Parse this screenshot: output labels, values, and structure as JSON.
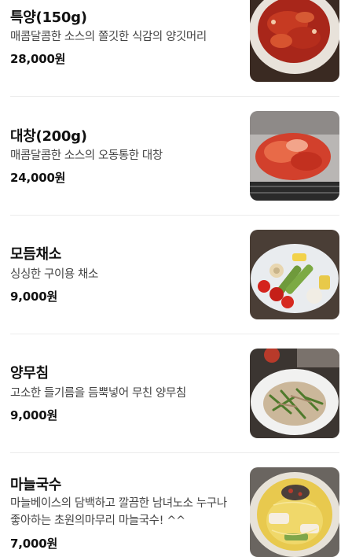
{
  "menu": {
    "items": [
      {
        "name": "특양(150g)",
        "description": "매콤달콤한 소스의 쫄깃한 식감의 양깃머리",
        "price": "28,000원",
        "photo_icon": "spicy-tripe-photo"
      },
      {
        "name": "대창(200g)",
        "description": "매콤달콤한 소스의 오동통한 대창",
        "price": "24,000원",
        "photo_icon": "spicy-intestine-photo"
      },
      {
        "name": "모듬채소",
        "description": "싱싱한 구이용 채소",
        "price": "9,000원",
        "photo_icon": "grilled-vegetables-photo"
      },
      {
        "name": "양무침",
        "description": "고소한 들기름을 듬뿍넣어 무친 양무침",
        "price": "9,000원",
        "photo_icon": "tripe-salad-photo"
      },
      {
        "name": "마늘국수",
        "description": "마늘베이스의 담백하고 깔끔한 남녀노소 누구나 좋아하는 초원의마무리 마늘국수! ^^",
        "price": "7,000원",
        "photo_icon": "garlic-noodle-photo"
      }
    ]
  }
}
